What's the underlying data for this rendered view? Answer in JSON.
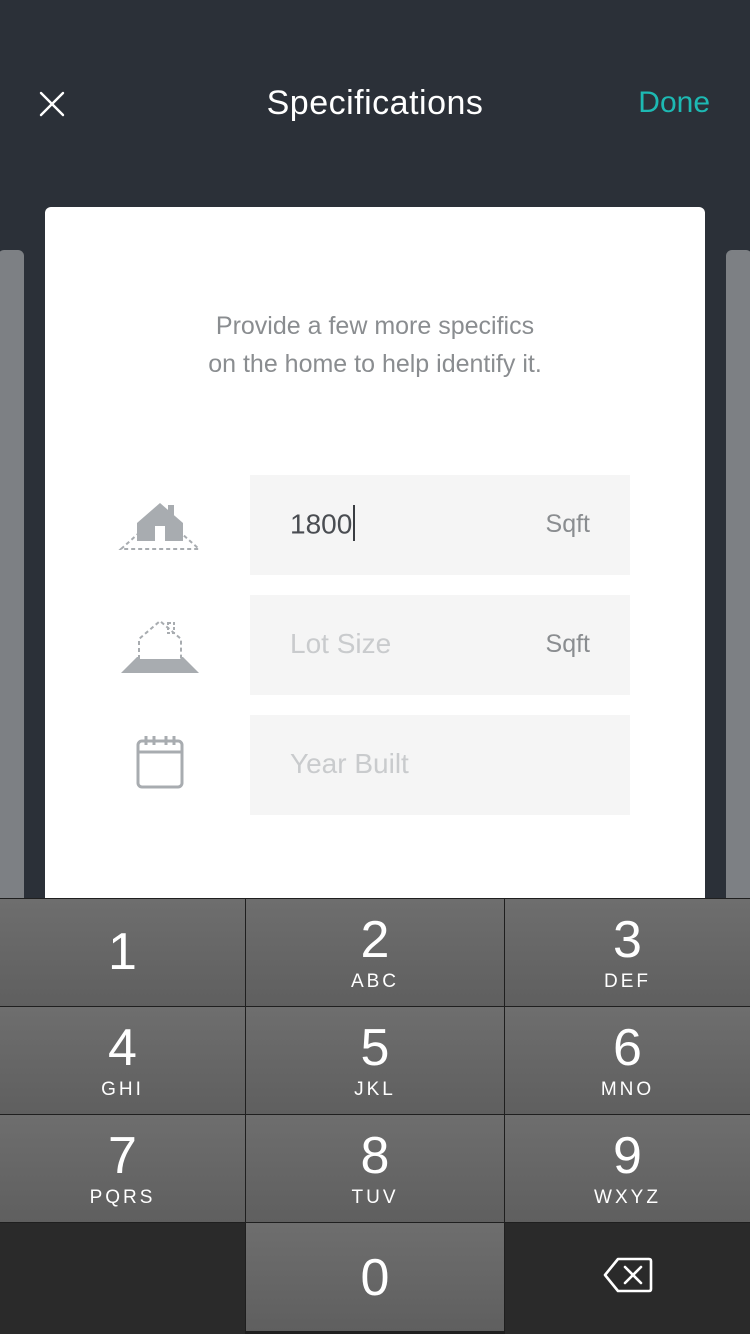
{
  "header": {
    "title": "Specifications",
    "done_label": "Done",
    "close_icon": "close-icon"
  },
  "card": {
    "description_line1": "Provide a few more specifics",
    "description_line2": "on the home to help identify it.",
    "fields": [
      {
        "icon": "house-area-icon",
        "value": "1800",
        "placeholder": "",
        "unit": "Sqft"
      },
      {
        "icon": "lot-size-icon",
        "value": "",
        "placeholder": "Lot Size",
        "unit": "Sqft"
      },
      {
        "icon": "calendar-icon",
        "value": "",
        "placeholder": "Year Built",
        "unit": ""
      }
    ]
  },
  "keypad": {
    "keys": [
      {
        "num": "1",
        "letters": ""
      },
      {
        "num": "2",
        "letters": "ABC"
      },
      {
        "num": "3",
        "letters": "DEF"
      },
      {
        "num": "4",
        "letters": "GHI"
      },
      {
        "num": "5",
        "letters": "JKL"
      },
      {
        "num": "6",
        "letters": "MNO"
      },
      {
        "num": "7",
        "letters": "PQRS"
      },
      {
        "num": "8",
        "letters": "TUV"
      },
      {
        "num": "9",
        "letters": "WXYZ"
      },
      {
        "num": "0",
        "letters": ""
      }
    ],
    "backspace_icon": "backspace-icon"
  },
  "colors": {
    "header_bg": "#2b3038",
    "accent": "#1db9b3",
    "card_bg": "#ffffff",
    "field_bg": "#f5f5f5",
    "key_bg": "#666666"
  }
}
